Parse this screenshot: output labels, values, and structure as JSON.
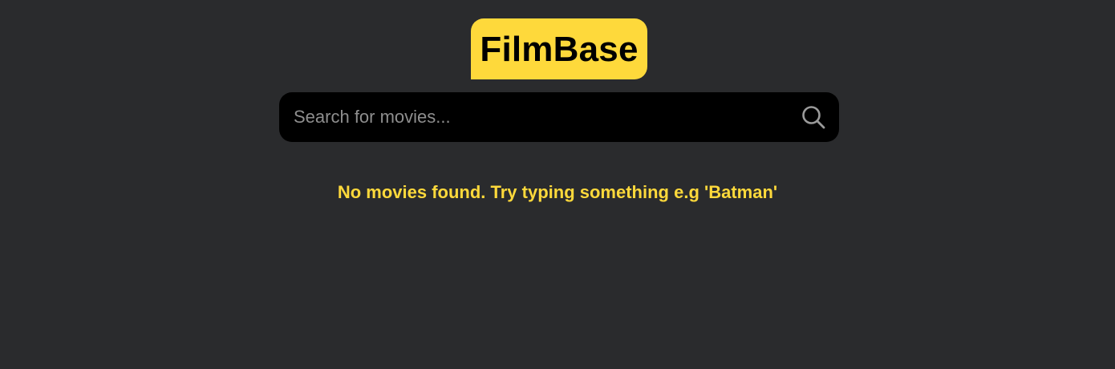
{
  "header": {
    "logo_text": "FilmBase"
  },
  "search": {
    "placeholder": "Search for movies...",
    "value": "",
    "icon": "search-icon"
  },
  "results": {
    "empty_message": "No movies found. Try typing something e.g 'Batman'"
  },
  "colors": {
    "background": "#2a2b2d",
    "accent": "#fed93b",
    "search_bg": "#000000",
    "placeholder": "#8e8e8e"
  }
}
